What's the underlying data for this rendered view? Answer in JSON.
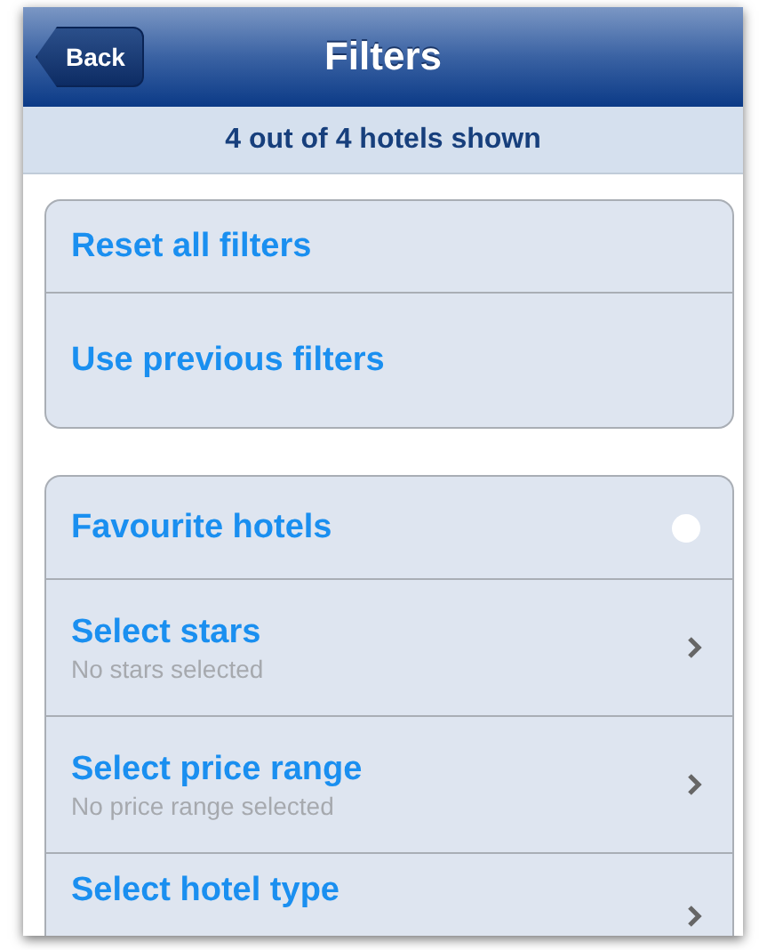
{
  "nav_bar": {
    "back_button": "Back",
    "title": "Filters"
  },
  "summary": "4 out of 4 hotels shown",
  "actions": [
    {
      "label": "Reset all filters"
    },
    {
      "label": "Use previous filters"
    }
  ],
  "filters": [
    {
      "kind": "toggle",
      "label": "Favourite hotels",
      "checked": false
    },
    {
      "kind": "disclosure",
      "label": "Select stars",
      "detail": "No stars selected"
    },
    {
      "kind": "disclosure",
      "label": "Select price range",
      "detail": "No price range selected"
    },
    {
      "kind": "disclosure",
      "label": "Select hotel type"
    }
  ]
}
